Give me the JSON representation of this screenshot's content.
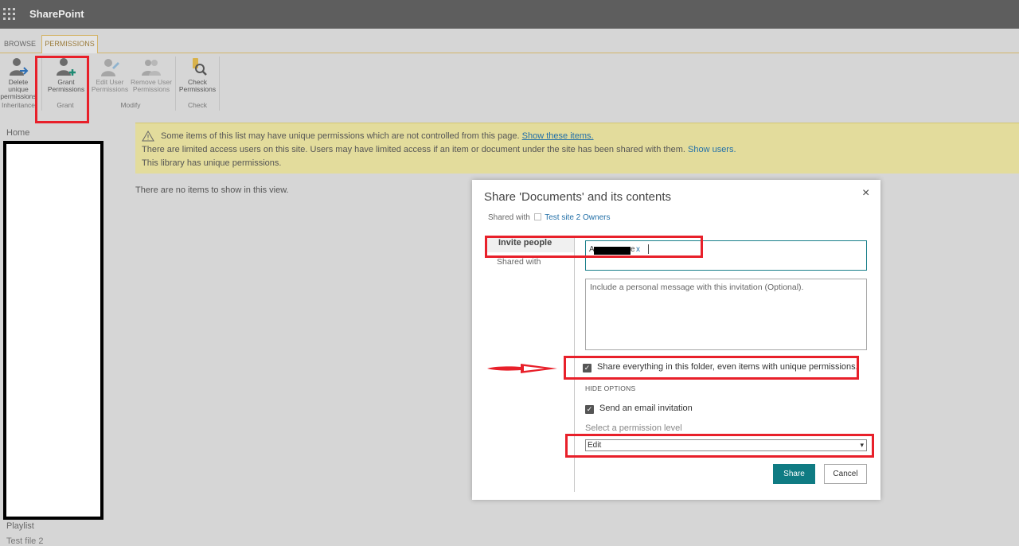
{
  "suite": {
    "brand": "SharePoint"
  },
  "ribbon": {
    "tabs": [
      "BROWSE",
      "PERMISSIONS"
    ],
    "active_tab": "PERMISSIONS",
    "buttons": {
      "delete_unique": {
        "line1": "Delete unique",
        "line2": "permissions"
      },
      "grant": {
        "line1": "Grant",
        "line2": "Permissions"
      },
      "edit_user": {
        "line1": "Edit User",
        "line2": "Permissions"
      },
      "remove_user": {
        "line1": "Remove User",
        "line2": "Permissions"
      },
      "check": {
        "line1": "Check",
        "line2": "Permissions"
      }
    },
    "groups": {
      "inheritance": "Inheritance",
      "grant": "Grant",
      "modify": "Modify",
      "check": "Check"
    }
  },
  "left_nav": {
    "home": "Home",
    "playlist": "Playlist",
    "cut_item": "Test file 2"
  },
  "warning": {
    "line1": "Some items of this list may have unique permissions which are not controlled from this page.",
    "line1_link": "Show these items.",
    "line2": "There are limited access users on this site. Users may have limited access if an item or document under the site has been shared with them.",
    "line2_link": "Show users.",
    "line3": "This library has unique permissions."
  },
  "empty_view": "There are no items to show in this view.",
  "dialog": {
    "title": "Share 'Documents' and its contents",
    "close": "×",
    "shared_with_label": "Shared with",
    "shared_with_group": "Test site 2 Owners",
    "tabs": {
      "invite": "Invite people",
      "shared": "Shared with"
    },
    "people": {
      "pre": "A",
      "post": "e",
      "remove": "x"
    },
    "message_placeholder": "Include a personal message with this invitation (Optional).",
    "share_everything": "Share everything in this folder, even items with unique permissions.",
    "hide_options": "HIDE OPTIONS",
    "send_email": "Send an email invitation",
    "permission_label": "Select a permission level",
    "permission_value": "Edit",
    "share_button": "Share",
    "cancel_button": "Cancel"
  },
  "colors": {
    "suite_bar": "#5e5e5e",
    "accent_teal": "#0f7b83",
    "annotation_red": "#e8202a",
    "warning_bg": "#e3dc9c",
    "link": "#2370a8"
  }
}
